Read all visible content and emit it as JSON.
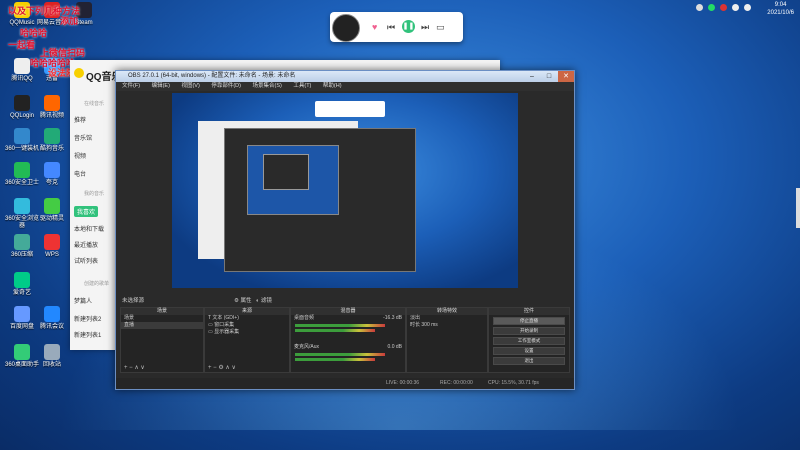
{
  "desktop": {
    "icons": [
      {
        "label": "QQMusic"
      },
      {
        "label": "网易云音乐"
      },
      {
        "label": "Steam"
      },
      {
        "label": "腾讯QQ"
      },
      {
        "label": "迅雷"
      },
      {
        "label": "QQLogin"
      },
      {
        "label": "腾讯视频"
      },
      {
        "label": "360一键装机"
      },
      {
        "label": "酷狗音乐"
      },
      {
        "label": "360安全卫士"
      },
      {
        "label": "夸克"
      },
      {
        "label": "360安全浏览器"
      },
      {
        "label": "驱动精灵"
      },
      {
        "label": "360压缩"
      },
      {
        "label": "WPS"
      },
      {
        "label": "优酷"
      },
      {
        "label": "爱奇艺"
      },
      {
        "label": "百度网盘"
      },
      {
        "label": "腾讯会议"
      },
      {
        "label": "360桌面助手"
      },
      {
        "label": "回收站"
      }
    ],
    "overlay_text": [
      "以及下列几种方法",
      "添加",
      "哈哈哈",
      "一起看",
      "上微信扫码",
      "哈哈哈哈哈",
      "设法随缘"
    ]
  },
  "tray": {
    "time": "9:04",
    "date": "2021/10/6"
  },
  "music_widget": {
    "like_icon": "heart-icon",
    "prev_icon": "prev-icon",
    "play_icon": "pause-icon",
    "next_icon": "next-icon",
    "lyrics_icon": "lyrics-icon"
  },
  "qq_music": {
    "title": "QQ音乐",
    "section_online": "在线音乐",
    "items": [
      "推荐",
      "音乐馆",
      "视频",
      "电台"
    ],
    "section_mine": "我的音乐",
    "mine_items": [
      "我喜欢",
      "本地和下载",
      "最近播放",
      "试听列表"
    ],
    "section_created": "创建的歌单",
    "playlists": [
      "梦篇人",
      "新建列表2",
      "新建列表1"
    ]
  },
  "obs": {
    "title": "OBS 27.0.1 (64-bit, windows) - 配置文件: 未命名 - 场景: 未命名",
    "menu": [
      "文件(F)",
      "编辑(E)",
      "视图(V)",
      "停靠部件(D)",
      "场景集合(S)",
      "工具(T)",
      "帮助(H)"
    ],
    "scene_label": "未选择源",
    "toolbar_props": "属性",
    "toolbar_filters": "滤镜",
    "panels": {
      "scenes": {
        "header": "场景",
        "rows": [
          "场景",
          "直播"
        ]
      },
      "sources": {
        "header": "来源",
        "rows": [
          "文本 (GDI+)",
          "窗口采集",
          "显示器采集"
        ]
      },
      "mixer": {
        "header": "混音器",
        "ch1": "桌面音频",
        "ch1_db": "-16.3 dB",
        "ch2": "麦克风/Aux",
        "ch2_db": "0.0 dB"
      },
      "transitions": {
        "header": "转场特效",
        "type": "淡出",
        "duration_label": "时长",
        "duration": "300 ms"
      },
      "controls": {
        "header": "控件",
        "buttons": [
          "停止直播",
          "开始录制",
          "工作室模式",
          "设置",
          "退出"
        ]
      }
    },
    "status": {
      "live": "LIVE: 00:00:36",
      "rec": "REC: 00:00:00",
      "cpu": "CPU: 15.5%, 30.71 fps"
    }
  }
}
